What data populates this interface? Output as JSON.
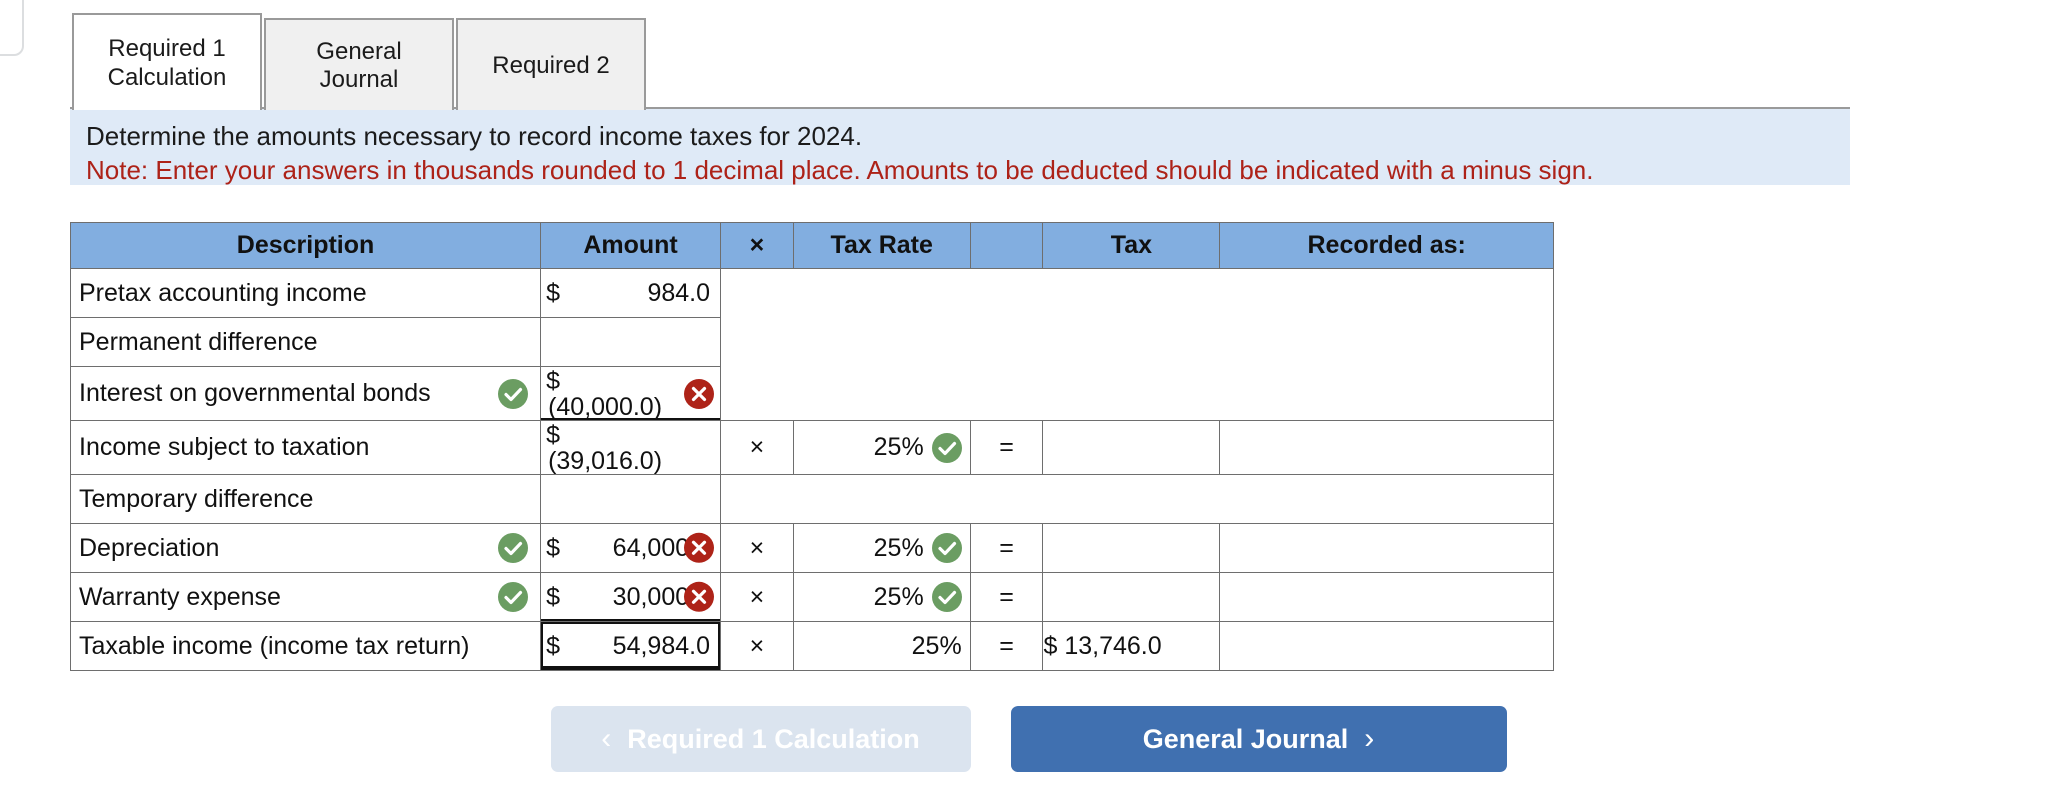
{
  "tabs": [
    {
      "label": "Required 1\nCalculation",
      "active": true
    },
    {
      "label": "General\nJournal",
      "active": false
    },
    {
      "label": "Required 2",
      "active": false
    }
  ],
  "banner": {
    "instruction": "Determine the amounts necessary to record income taxes for 2024.",
    "note": "Note: Enter your answers in thousands rounded to 1 decimal place. Amounts to be deducted should be indicated with a minus sign."
  },
  "table": {
    "headers": {
      "description": "Description",
      "amount": "Amount",
      "multiply": "×",
      "tax_rate": "Tax Rate",
      "equals": "",
      "tax": "Tax",
      "recorded_as": "Recorded as:"
    },
    "rows": [
      {
        "description": "Pretax accounting income",
        "desc_status": "",
        "amount_dollar": "$",
        "amount_value": "984.0",
        "amount_status": "",
        "amount_wrap": false,
        "multiply": "",
        "tax_rate": "",
        "rate_status": "",
        "equals": "",
        "tax": "",
        "recorded_as": "",
        "has_calc_columns": false
      },
      {
        "description": "Permanent difference",
        "desc_status": "",
        "amount_dollar": "",
        "amount_value": "",
        "amount_status": "",
        "amount_wrap": false,
        "multiply": "",
        "tax_rate": "",
        "rate_status": "",
        "equals": "",
        "tax": "",
        "recorded_as": "",
        "has_calc_columns": false
      },
      {
        "description": "Interest on governmental bonds",
        "desc_status": "ok",
        "amount_dollar": "$",
        "amount_value": "(40,000.0)",
        "amount_status": "bad",
        "amount_wrap": true,
        "multiply": "",
        "tax_rate": "",
        "rate_status": "",
        "equals": "",
        "tax": "",
        "recorded_as": "",
        "has_calc_columns": false
      },
      {
        "description": "Income subject to taxation",
        "desc_status": "",
        "amount_dollar": "$",
        "amount_value": "(39,016.0)",
        "amount_status": "",
        "amount_wrap": true,
        "multiply": "×",
        "tax_rate": "25%",
        "rate_status": "ok",
        "equals": "=",
        "tax": "",
        "recorded_as": "",
        "has_calc_columns": true
      },
      {
        "description": "Temporary difference",
        "desc_status": "",
        "amount_dollar": "",
        "amount_value": "",
        "amount_status": "",
        "amount_wrap": false,
        "multiply": "",
        "tax_rate": "",
        "rate_status": "",
        "equals": "",
        "tax": "",
        "recorded_as": "",
        "has_calc_columns": false
      },
      {
        "description": "Depreciation",
        "desc_status": "ok",
        "amount_dollar": "$",
        "amount_value": "64,000.0",
        "amount_status": "bad",
        "amount_wrap": false,
        "multiply": "×",
        "tax_rate": "25%",
        "rate_status": "ok",
        "equals": "=",
        "tax": "",
        "recorded_as": "",
        "has_calc_columns": true
      },
      {
        "description": "Warranty expense",
        "desc_status": "ok",
        "amount_dollar": "$",
        "amount_value": "30,000.0",
        "amount_status": "bad",
        "amount_wrap": false,
        "multiply": "×",
        "tax_rate": "25%",
        "rate_status": "ok",
        "equals": "=",
        "tax": "",
        "recorded_as": "",
        "has_calc_columns": true
      },
      {
        "description": "Taxable income (income tax return)",
        "desc_status": "",
        "amount_dollar": "$",
        "amount_value": "54,984.0",
        "amount_status": "focused",
        "amount_wrap": false,
        "multiply": "×",
        "tax_rate": "25%",
        "rate_status": "",
        "equals": "=",
        "tax": "$ 13,746.0",
        "recorded_as": "",
        "has_calc_columns": true
      }
    ]
  },
  "footer": {
    "prev_label": "Required 1 Calculation",
    "prev_chevron": "‹",
    "next_label": "General Journal",
    "next_chevron": "›"
  },
  "colors": {
    "header_blue": "#82aee0",
    "banner_blue": "#dfeaf7",
    "note_red": "#ad2218",
    "badge_ok_green": "#6b9d62",
    "badge_bad_red": "#ae2318",
    "next_button_blue": "#4070b0",
    "prev_button_gray": "#dbe4ef"
  }
}
